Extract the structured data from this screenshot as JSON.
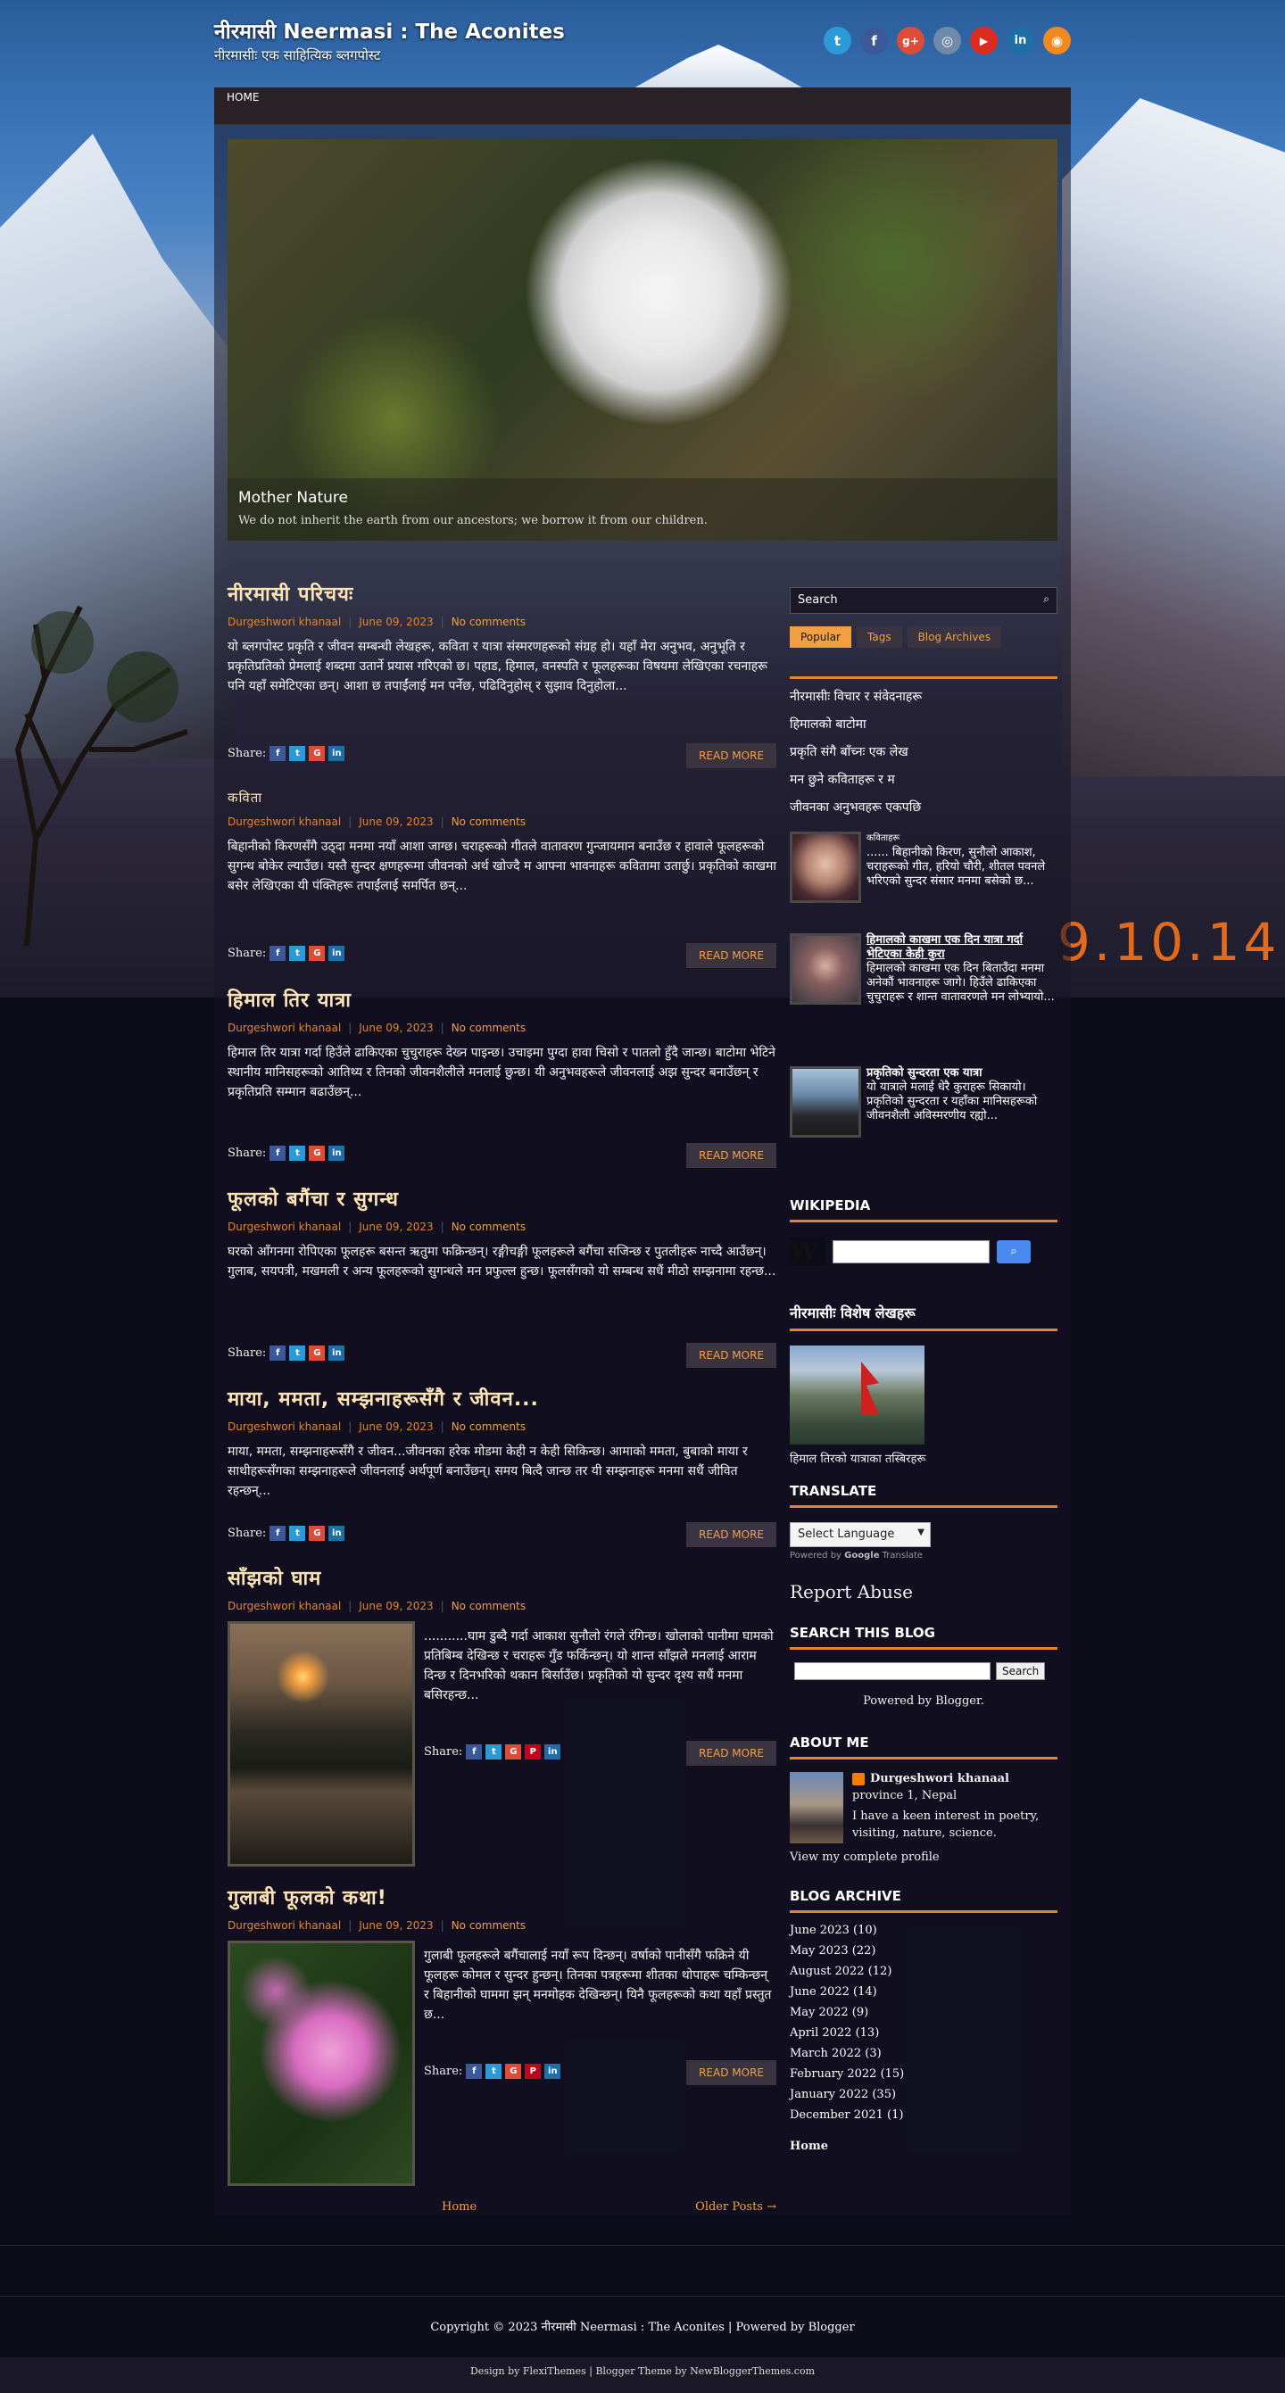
{
  "blog": {
    "title": "नीरमासी Neermasi : The Aconites",
    "description": "नीरमासीः एक साहित्यिक ब्लगपोस्ट"
  },
  "social": [
    {
      "name": "twitter-icon",
      "glyph": "t",
      "color": "#2d9ad8"
    },
    {
      "name": "facebook-icon",
      "glyph": "f",
      "color": "#3b5998"
    },
    {
      "name": "google-plus-icon",
      "glyph": "g+",
      "color": "#dd4b39"
    },
    {
      "name": "instagram-icon",
      "glyph": "◎",
      "color": "#6f8aa8"
    },
    {
      "name": "youtube-icon",
      "glyph": "▶",
      "color": "#dd2c1f"
    },
    {
      "name": "linkedin-icon",
      "glyph": "in",
      "color": "#1d6fa5"
    },
    {
      "name": "rss-icon",
      "glyph": "◉",
      "color": "#f2891e"
    }
  ],
  "nav": {
    "home": "HOME"
  },
  "slider": {
    "caption_title": "Mother Nature",
    "caption_text": "We do not inherit the earth from our ancestors; we borrow it from our children."
  },
  "background_date": "9.10.14",
  "posts": [
    {
      "title": "नीरमासी परिचयः",
      "author": "Durgeshwori khanaal",
      "date": "June 09, 2023",
      "comments": "No comments",
      "excerpt": " यो ब्लगपोस्ट प्रकृति र जीवन सम्बन्धी लेखहरू, कविता र यात्रा संस्मरणहरूको संग्रह हो। यहाँ मेरा अनुभव, अनुभूति र प्रकृतिप्रतिको प्रेमलाई शब्दमा उतार्ने प्रयास गरिएको छ। पहाड, हिमाल, वनस्पति र फूलहरूका विषयमा लेखिएका रचनाहरू पनि यहाँ समेटिएका छन्। आशा छ तपाईंलाई मन पर्नेछ, पढिदिनुहोस् र सुझाव दिनुहोला...",
      "share": "Share:",
      "read_more": "READ MORE"
    },
    {
      "title": "कविता",
      "author": "Durgeshwori khanaal",
      "date": "June 09, 2023",
      "comments": "No comments",
      "excerpt": " बिहानीको किरणसँगै उठ्दा मनमा नयाँ आशा जाग्छ। चराहरूको गीतले वातावरण गुन्जायमान बनाउँछ र हावाले फूलहरूको सुगन्ध बोकेर ल्याउँछ। यस्तै सुन्दर क्षणहरूमा जीवनको अर्थ खोज्दै म आफ्ना भावनाहरू कवितामा उतार्छु। प्रकृतिको काखमा बसेर लेखिएका यी पंक्तिहरू तपाईंलाई समर्पित छन्...",
      "share": "Share:",
      "read_more": "READ MORE"
    },
    {
      "title": "हिमाल तिर यात्रा",
      "author": "Durgeshwori khanaal",
      "date": "June 09, 2023",
      "comments": "No comments",
      "excerpt": " हिमाल तिर यात्रा गर्दा हिउँले ढाकिएका चुचुराहरू देख्न पाइन्छ। उचाइमा पुग्दा हावा चिसो र पातलो हुँदै जान्छ। बाटोमा भेटिने स्थानीय मानिसहरूको आतिथ्य र तिनको जीवनशैलीले मनलाई छुन्छ। यी अनुभवहरूले जीवनलाई अझ सुन्दर बनाउँछन् र प्रकृतिप्रति सम्मान बढाउँछन्...",
      "share": "Share:",
      "read_more": "READ MORE"
    },
    {
      "title": "फूलको बगैंचा र सुगन्ध",
      "author": "Durgeshwori khanaal",
      "date": "June 09, 2023",
      "comments": "No comments",
      "excerpt": " घरको आँगनमा रोपिएका फूलहरू बसन्त ऋतुमा फक्रिन्छन्। रङ्गीचङ्गी फूलहरूले बगैंचा सजिन्छ र पुतलीहरू नाच्दै आउँछन्। गुलाब, सयपत्री, मखमली र अन्य फूलहरूको सुगन्धले मन प्रफुल्ल हुन्छ। फूलसँगको यो सम्बन्ध सधैं मीठो सम्झनामा रहन्छ...",
      "share": "Share:",
      "read_more": "READ MORE"
    },
    {
      "title": "माया, ममता, सम्झनाहरूसँगै र जीवन...",
      "author": "Durgeshwori khanaal",
      "date": "June 09, 2023",
      "comments": "No comments",
      "excerpt": " माया, ममता, सम्झनाहरूसँगै र जीवन...जीवनका हरेक मोडमा केही न केही सिकिन्छ। आमाको ममता, बुबाको माया र साथीहरूसँगका सम्झनाहरूले जीवनलाई अर्थपूर्ण बनाउँछन्। समय बित्दै जान्छ तर यी सम्झनाहरू मनमा सधैं जीवित रहन्छन्...",
      "share": "Share:",
      "read_more": "READ MORE"
    },
    {
      "title": "साँझको घाम",
      "author": "Durgeshwori khanaal",
      "date": "June 09, 2023",
      "comments": "No comments",
      "excerpt": " ...........घाम डुब्दै गर्दा आकाश सुनौलो रंगले रंगिन्छ। खोलाको पानीमा घामको प्रतिबिम्ब देखिन्छ र चराहरू गुँड फर्किन्छन्। यो शान्त साँझले मनलाई आराम दिन्छ र दिनभरिको थकान बिर्साउँछ। प्रकृतिको यो सुन्दर दृश्य सधैं मनमा बसिरहन्छ...",
      "share": "Share:",
      "read_more": "READ MORE"
    },
    {
      "title": "गुलाबी फूलको कथा!",
      "author": "Durgeshwori khanaal",
      "date": "June 09, 2023",
      "comments": "No comments",
      "excerpt": " गुलाबी फूलहरूले बगैंचालाई नयाँ रूप दिन्छन्। वर्षाको पानीसँगै फक्रिने यी फूलहरू कोमल र सुन्दर हुन्छन्। तिनका पत्रहरूमा शीतका थोपाहरू चम्किन्छन् र बिहानीको घाममा झन् मनमोहक देखिन्छन्। यिनै फूलहरूको कथा यहाँ प्रस्तुत छ...",
      "share": "Share:",
      "read_more": "READ MORE"
    }
  ],
  "pager": {
    "home": "Home",
    "older": "Older Posts →"
  },
  "sidebar": {
    "search_placeholder": "Search",
    "tabs": [
      "Popular",
      "Tags",
      "Blog Archives"
    ],
    "popular_list": [
      "नीरमासीः विचार र संवेदनाहरू",
      "हिमालको बाटोमा",
      "प्रकृति संगै बाँच्नः एक लेख",
      "मन छुने कविताहरू र म",
      "जीवनका अनुभवहरू एकपछि"
    ],
    "popular_posts": [
      {
        "label": "कविताहरू",
        "title": "...... बिहानीको किरण, सुनौलो आकाश, ",
        "text": "चराहरूको गीत, हरियो चौरी, शीतल पवनले भरिएको सुन्दर संसार मनमा बसेको छ..."
      },
      {
        "title": "हिमालको काखमा एक दिन यात्रा गर्दा भेटिएका केही कुरा",
        "text": "हिमालको काखमा एक दिन बिताउँदा मनमा अनेकौं भावनाहरू जागे। हिउँले ढाकिएका चुचुराहरू र शान्त वातावरणले मन लोभ्यायो..."
      },
      {
        "title": "प्रकृतिको सुन्दरता एक यात्रा",
        "text": "यो यात्राले मलाई धेरै कुराहरू सिकायो। प्रकृतिको सुन्दरता र यहाँका मानिसहरूको जीवनशैली अविस्मरणीय रह्यो..."
      }
    ],
    "wikipedia_title": "WIKIPEDIA",
    "featured_title": "नीरमासीः विशेष लेखहरू",
    "featured_caption": "हिमाल तिरको यात्राका तस्बिरहरू",
    "translate_title": "TRANSLATE",
    "translate_select": "Select Language",
    "translate_powered": "Powered by",
    "translate_google": "Google",
    "translate_word": "Translate",
    "report_abuse": "Report Abuse",
    "search_blog_title": "SEARCH THIS BLOG",
    "search_button": "Search",
    "powered_blogger": "Powered by Blogger.",
    "about_title": "ABOUT ME",
    "about_name": "Durgeshwori khanaal",
    "about_location": "province 1, Nepal",
    "about_text": "I have a keen interest in poetry, visiting, nature, science.",
    "about_profile": "View my complete profile",
    "archive_title": "BLOG ARCHIVE",
    "archive": [
      "June 2023 (10)",
      "May 2023 (22)",
      "August 2022 (12)",
      "June 2022 (14)",
      "May 2022 (9)",
      "April 2022 (13)",
      "March 2022 (3)",
      "February 2022 (15)",
      "January 2022 (35)",
      "December 2021 (1)"
    ],
    "home_link": "Home"
  },
  "footer": {
    "copyright": "Copyright © 2023 नीरमासी Neermasi : The Aconites | Powered by Blogger",
    "credits": "Design by FlexiThemes | Blogger Theme by NewBloggerThemes.com"
  }
}
